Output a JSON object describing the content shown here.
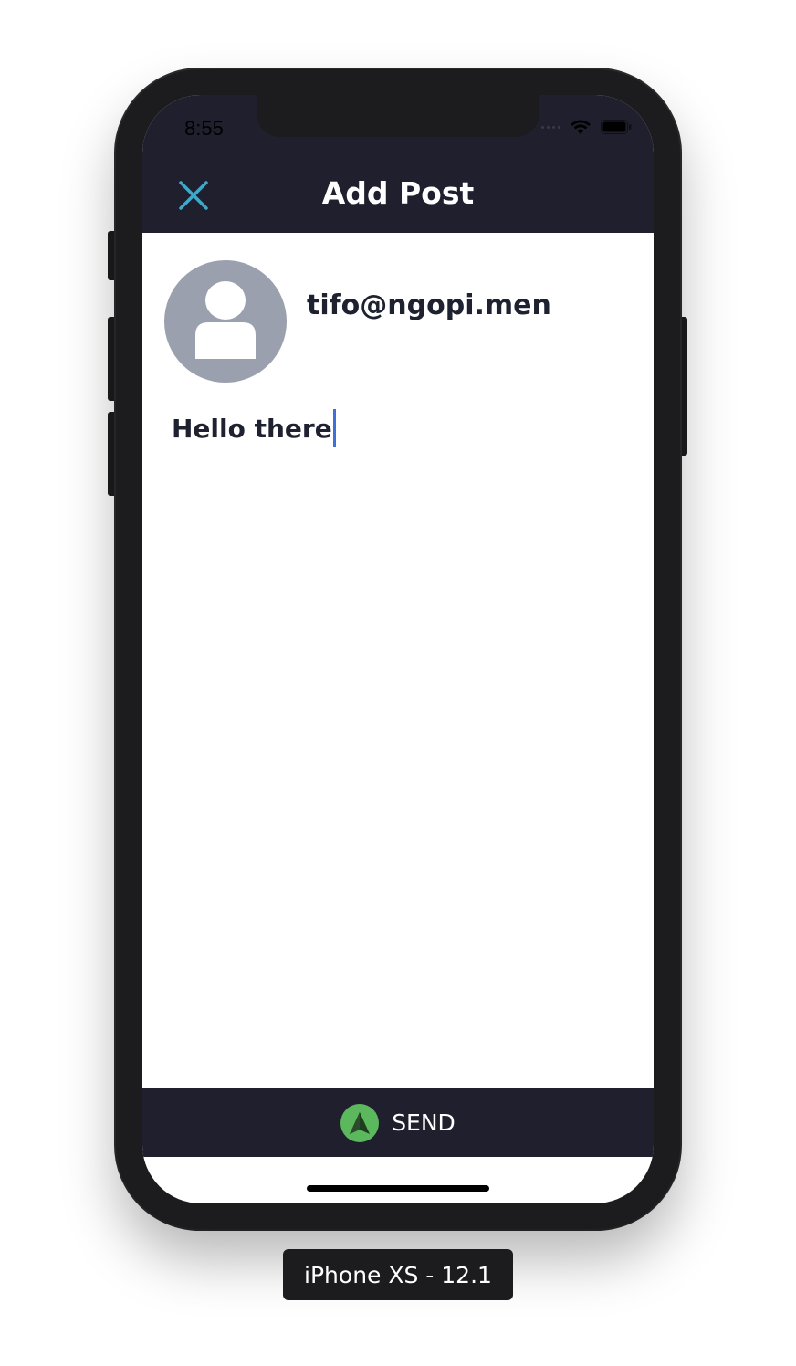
{
  "status_bar": {
    "time": "8:55"
  },
  "nav": {
    "title": "Add Post",
    "close_icon": "close-icon"
  },
  "post": {
    "username": "tifo@ngopi.men",
    "text": "Hello there",
    "avatar_icon": "person-icon"
  },
  "send": {
    "label": "SEND",
    "icon": "send-arrow-icon"
  },
  "device": {
    "label": "iPhone XS - 12.1"
  },
  "colors": {
    "nav_background": "#201f2e",
    "close_accent": "#3fa9c9",
    "send_icon": "#5cb85c",
    "avatar": "#9aa0ad",
    "cursor": "#3f6fd8"
  }
}
